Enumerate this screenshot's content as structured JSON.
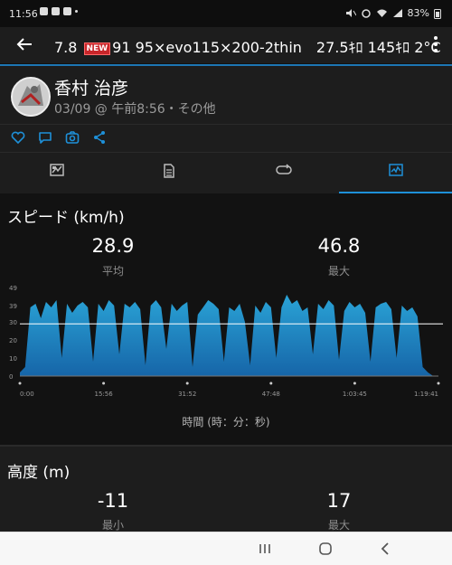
{
  "status_bar": {
    "time": "11:56",
    "battery": "83%"
  },
  "app_bar": {
    "title_prefix": "7.8",
    "new_badge": "NEW",
    "title_rest": "91 95×evo115×200-2thin　27.5ｷﾛ 145ｷﾛ 2°C"
  },
  "profile": {
    "name": "香村 治彦",
    "meta": "03/09 @ 午前8:56・その他"
  },
  "tabs": [
    {
      "name": "overview",
      "icon": "map-icon"
    },
    {
      "name": "details",
      "icon": "document-icon"
    },
    {
      "name": "laps",
      "icon": "loop-icon"
    },
    {
      "name": "charts",
      "icon": "chart-icon",
      "active": true
    }
  ],
  "speed": {
    "title": "スピード (km/h)",
    "avg_value": "28.9",
    "avg_label": "平均",
    "max_value": "46.8",
    "max_label": "最大",
    "x_axis_title": "時間 (時：分：秒)"
  },
  "altitude": {
    "title": "高度 (m)",
    "min_value": "-11",
    "min_label": "最小",
    "max_value": "17",
    "max_label": "最大"
  },
  "colors": {
    "accent": "#1e90d8",
    "chart_fill_top": "#2aa3d6",
    "chart_fill_bottom": "#1665a8",
    "avg_line": "#ffffff"
  },
  "chart_data": {
    "type": "area",
    "title": "スピード (km/h)",
    "xlabel": "時間 (時：分：秒)",
    "ylabel": "",
    "yticks": [
      "0",
      "10",
      "20",
      "30",
      "39",
      "49"
    ],
    "ylim": [
      0,
      49
    ],
    "xticks": [
      "0:00",
      "15:56",
      "31:52",
      "47:48",
      "1:03:45",
      "1:19:41"
    ],
    "average_line": 28.9,
    "x_minutes": [
      0,
      1,
      2,
      3,
      4,
      5,
      6,
      7,
      8,
      9,
      10,
      11,
      12,
      13,
      14,
      15,
      16,
      17,
      18,
      19,
      20,
      21,
      22,
      23,
      24,
      25,
      26,
      27,
      28,
      29,
      30,
      31,
      32,
      33,
      34,
      35,
      36,
      37,
      38,
      39,
      40,
      41,
      42,
      43,
      44,
      45,
      46,
      47,
      48,
      49,
      50,
      51,
      52,
      53,
      54,
      55,
      56,
      57,
      58,
      59,
      60,
      61,
      62,
      63,
      64,
      65,
      66,
      67,
      68,
      69,
      70,
      71,
      72,
      73,
      74,
      75,
      76,
      77,
      78,
      79,
      80
    ],
    "values": [
      2,
      5,
      38,
      40,
      32,
      41,
      38,
      42,
      10,
      40,
      35,
      39,
      41,
      38,
      8,
      40,
      36,
      42,
      39,
      12,
      40,
      38,
      41,
      37,
      6,
      39,
      42,
      38,
      15,
      40,
      36,
      39,
      41,
      5,
      34,
      38,
      42,
      40,
      37,
      8,
      38,
      36,
      40,
      30,
      6,
      39,
      35,
      41,
      38,
      10,
      38,
      45,
      40,
      42,
      36,
      38,
      12,
      40,
      37,
      42,
      39,
      9,
      36,
      41,
      38,
      40,
      35,
      8,
      38,
      40,
      41,
      37,
      10,
      39,
      36,
      38,
      33,
      5,
      2,
      0,
      0
    ]
  }
}
